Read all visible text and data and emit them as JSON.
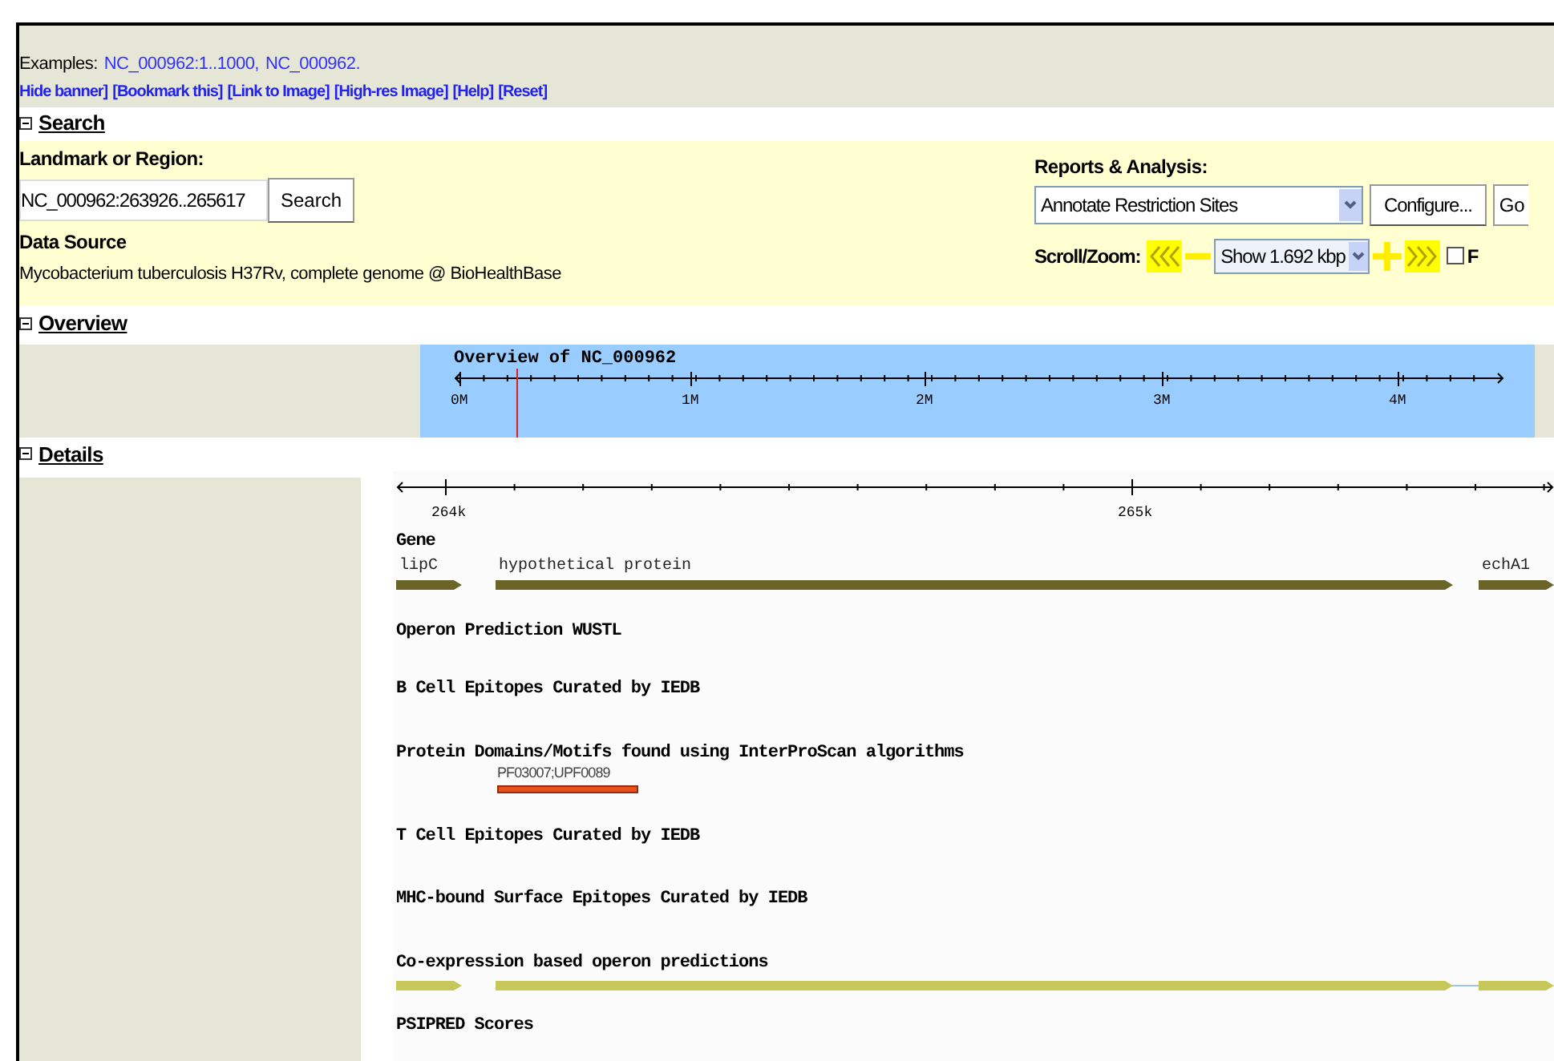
{
  "banner": {
    "examples_label": "Examples:",
    "examples": [
      "NC_000962:1..1000,",
      "NC_000962."
    ],
    "links": [
      "Hide banner]",
      "[Bookmark this]",
      "[Link to Image]",
      "[High-res Image]",
      "[Help]",
      "[Reset]"
    ]
  },
  "sections": [
    {
      "label": "Search",
      "expanded": true
    },
    {
      "label": "Overview",
      "expanded": true
    },
    {
      "label": "Details",
      "expanded": true
    }
  ],
  "search": {
    "landmark_label": "Landmark or Region:",
    "landmark_value": "NC_000962:263926..265617",
    "search_button": "Search",
    "data_source_label": "Data Source",
    "data_source": "Mycobacterium tuberculosis H37Rv, complete genome @ BioHealthBase",
    "reports_label": "Reports & Analysis:",
    "report_select": "Annotate Restriction Sites",
    "configure_button": "Configure...",
    "go_button": "Go",
    "scroll_label": "Scroll/Zoom:",
    "zoom_select": "Show 1.692 kbp",
    "flip": {
      "label": "F",
      "checked": false
    }
  },
  "overview": {
    "title": "Overview of NC_000962",
    "ticks": [
      "0M",
      "1M",
      "2M",
      "3M",
      "4M"
    ]
  },
  "details": {
    "ticks": [
      "264k",
      "265k"
    ],
    "tracks": [
      {
        "name": "Gene",
        "features": [
          {
            "kind": "gene",
            "label": "lipC"
          },
          {
            "kind": "gene",
            "label": "hypothetical protein"
          },
          {
            "kind": "gene",
            "label": "echA1"
          }
        ]
      },
      {
        "name": "Operon Prediction WUSTL"
      },
      {
        "name": "B Cell Epitopes Curated by IEDB"
      },
      {
        "name": "Protein Domains/Motifs found using InterProScan algorithms",
        "features": [
          {
            "kind": "domain",
            "label": "PF03007;UPF0089"
          }
        ]
      },
      {
        "name": "T Cell Epitopes Curated by IEDB"
      },
      {
        "name": "MHC-bound Surface Epitopes Curated by IEDB"
      },
      {
        "name": "Co-expression based operon predictions",
        "features": [
          {
            "kind": "operon"
          },
          {
            "kind": "operon"
          },
          {
            "kind": "operon"
          }
        ]
      },
      {
        "name": "PSIPRED Scores"
      }
    ]
  }
}
